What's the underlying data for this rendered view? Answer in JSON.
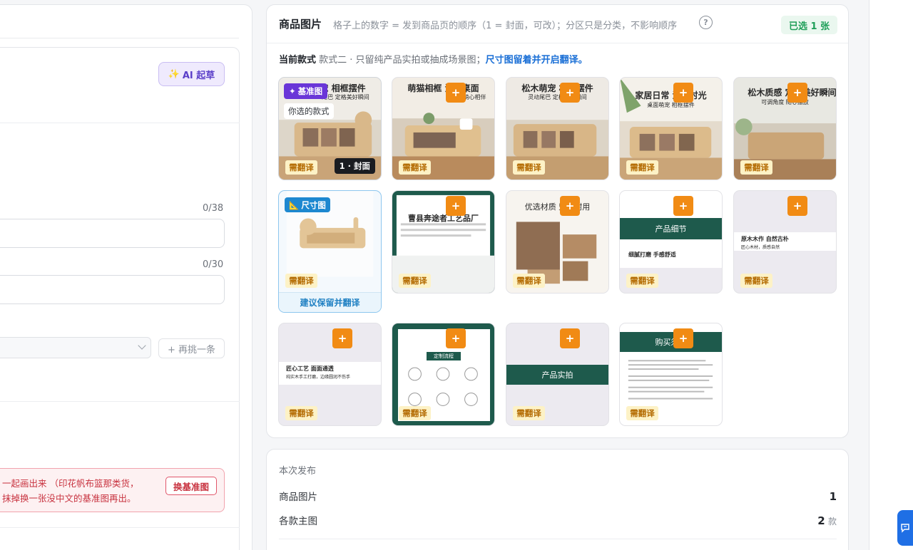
{
  "left": {
    "ai_draft_label": "AI 起草",
    "counter_title": "0/38",
    "counter_sub": "0/30",
    "repick_label": "+ 再挑一条",
    "alert_text": "一起画出来 （印花帆布篮那类货，抹掉换一张没中文的基准图再出。",
    "alert_button": "换基准图"
  },
  "gallery": {
    "title": "商品图片",
    "hint": "格子上的数字 = 发到商品页的顺序（1 = 封面，可改）；分区只是分类，不影响顺序",
    "help": "?",
    "selected_count": "已选 1 张",
    "style_key": "当前款式",
    "style_value": "款式二 · 只留纯产品实拍或抽成场景图；",
    "style_link": "尺寸图留着并开启翻译。",
    "plus": "+",
    "need_translate": "需翻译",
    "base_label": "基准图",
    "your_style": "你选的款式",
    "cover_label": "1 · 封面",
    "size_label": "尺寸图",
    "size_hint": "建议保留并翻译",
    "tiles": [
      {
        "text": "宠 相框摆件",
        "sub": "尾巴 定格美好瞬间"
      },
      {
        "text": "萌猫相框 治愈桌面",
        "sub": "爱宠萌心相伴"
      },
      {
        "text": "松木萌宠 相框摆件",
        "sub": "灵动尾巴 定格美好瞬间"
      },
      {
        "text": "家居日常 温暖时光",
        "sub": "桌面萌宠 相框摆件"
      },
      {
        "text": "松木质感 定格美好瞬间",
        "sub": "可调角度 随心摆放"
      },
      {
        "text": "",
        "sub": ""
      },
      {
        "text": "曹县奔途者工艺品厂",
        "sub": ""
      },
      {
        "text": "优选材质 坚固耐用",
        "sub": ""
      },
      {
        "text": "产品细节",
        "sub": "细腻打磨 手感舒适"
      },
      {
        "text": "原木木作 自然古朴",
        "sub": "匠心木材，质感自然"
      },
      {
        "text": "匠心工艺 面面通透",
        "sub": "纯实木手工打磨，边缘圆润不伤手"
      },
      {
        "text": "定制流程",
        "sub": ""
      },
      {
        "text": "产品实拍",
        "sub": ""
      },
      {
        "text": "购买须知",
        "sub": ""
      }
    ]
  },
  "publish": {
    "title": "本次发布",
    "rows": [
      {
        "label": "商品图片",
        "value": "1",
        "unit": ""
      },
      {
        "label": "各款主图",
        "value": "2",
        "unit": "款"
      }
    ]
  },
  "colors": {
    "accent_orange": "#f18b14",
    "base_purple": "#6a36d8",
    "size_blue": "#1d88d0",
    "brand_green": "#1e5a4c",
    "link_blue": "#1a6fd6"
  }
}
